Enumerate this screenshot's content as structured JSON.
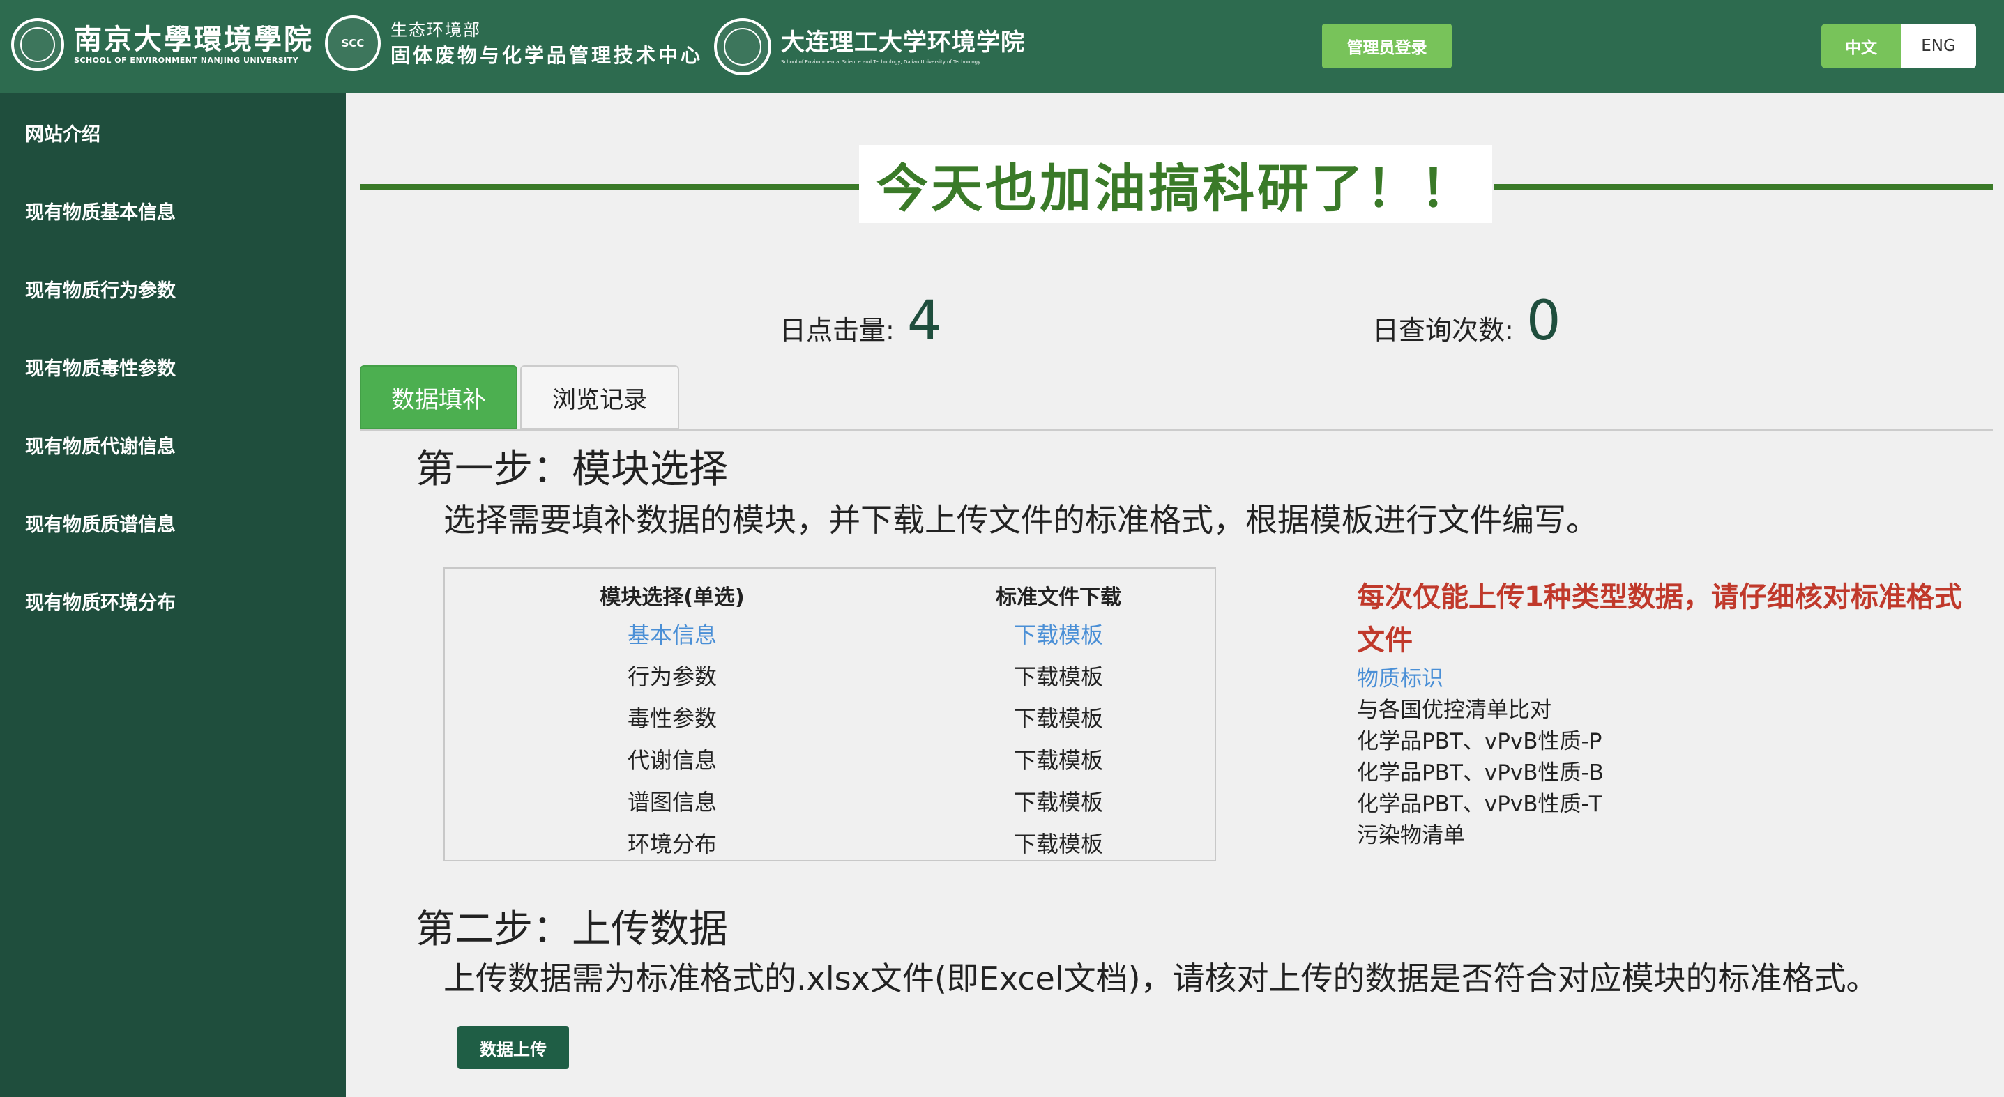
{
  "header": {
    "logo1": {
      "title": "南京大學環境學院",
      "subtitle": "SCHOOL OF ENVIRONMENT NANJING UNIVERSITY"
    },
    "logo2": {
      "emblem_text": "SCC",
      "title": "生态环境部",
      "subtitle": "固体废物与化学品管理技术中心"
    },
    "logo3": {
      "title": "大连理工大学环境学院",
      "subtitle": "School of Environmental Science and Technology, Dalian University of Technology"
    },
    "admin_login": "管理员登录",
    "lang_zh": "中文",
    "lang_en": "ENG"
  },
  "sidebar": {
    "items": [
      {
        "label": "网站介绍"
      },
      {
        "label": "现有物质基本信息"
      },
      {
        "label": "现有物质行为参数"
      },
      {
        "label": "现有物质毒性参数"
      },
      {
        "label": "现有物质代谢信息"
      },
      {
        "label": "现有物质质谱信息"
      },
      {
        "label": "现有物质环境分布"
      }
    ]
  },
  "banner": {
    "text": "今天也加油搞科研了！！"
  },
  "stats": {
    "clicks_label": "日点击量:",
    "clicks_value": "4",
    "queries_label": "日查询次数:",
    "queries_value": "0"
  },
  "tabs": [
    {
      "label": "数据填补",
      "active": true
    },
    {
      "label": "浏览记录",
      "active": false
    }
  ],
  "step1": {
    "title": "第一步：模块选择",
    "desc": "选择需要填补数据的模块，并下载上传文件的标准格式，根据模板进行文件编写。",
    "col_module": "模块选择(单选)",
    "col_download": "标准文件下载",
    "rows": [
      {
        "module": "基本信息",
        "download": "下载模板",
        "selected": true
      },
      {
        "module": "行为参数",
        "download": "下载模板",
        "selected": false
      },
      {
        "module": "毒性参数",
        "download": "下载模板",
        "selected": false
      },
      {
        "module": "代谢信息",
        "download": "下载模板",
        "selected": false
      },
      {
        "module": "谱图信息",
        "download": "下载模板",
        "selected": false
      },
      {
        "module": "环境分布",
        "download": "下载模板",
        "selected": false
      }
    ]
  },
  "notice": {
    "warning": "每次仅能上传1种类型数据，请仔细核对标准格式文件",
    "items": [
      {
        "label": "物质标识",
        "highlight": true
      },
      {
        "label": "与各国优控清单比对",
        "highlight": false
      },
      {
        "label": "化学品PBT、vPvB性质-P",
        "highlight": false
      },
      {
        "label": "化学品PBT、vPvB性质-B",
        "highlight": false
      },
      {
        "label": "化学品PBT、vPvB性质-T",
        "highlight": false
      },
      {
        "label": "污染物清单",
        "highlight": false
      }
    ]
  },
  "step2": {
    "title": "第二步：上传数据",
    "desc": "上传数据需为标准格式的.xlsx文件(即Excel文档)，请核对上传的数据是否符合对应模块的标准格式。",
    "upload_button": "数据上传"
  },
  "colors": {
    "header_bg": "#2d6b4f",
    "sidebar_bg": "#1f4e3d",
    "accent_green": "#78c35a",
    "banner_green": "#3a7a28",
    "tab_active": "#4caf50",
    "warning_red": "#c0392b",
    "link_blue": "#4a8fd6"
  }
}
